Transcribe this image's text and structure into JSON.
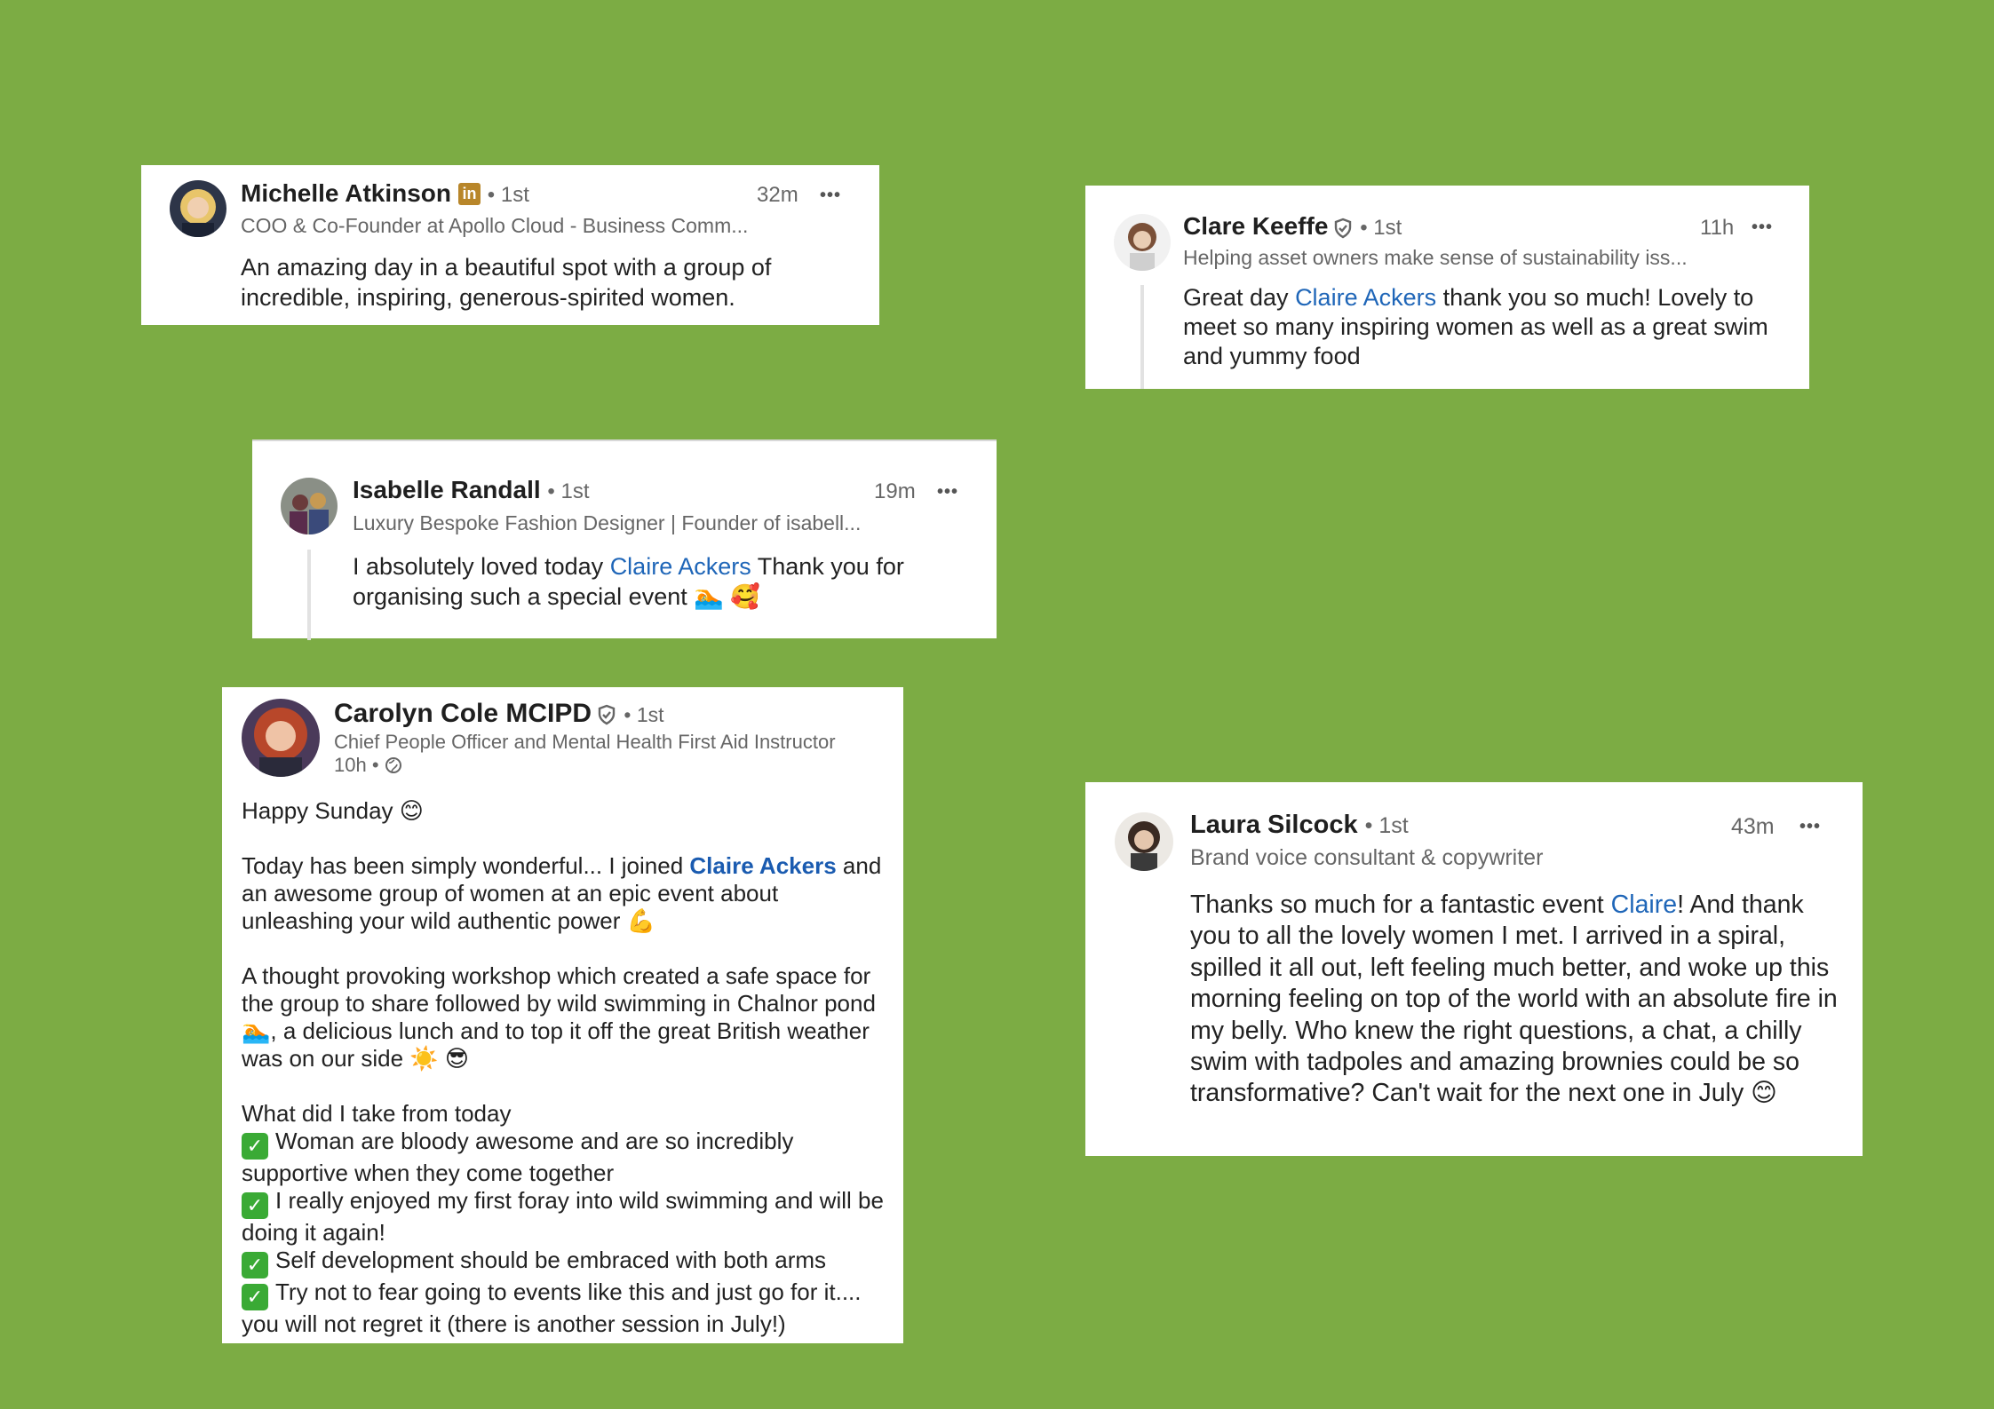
{
  "posts": {
    "michelle": {
      "name": "Michelle Atkinson",
      "badge_icon": "linkedin-icon",
      "badge_text": "in",
      "degree": "• 1st",
      "headline": "COO & Co-Founder at Apollo Cloud - Business Comm...",
      "time": "32m",
      "more": "•••",
      "text": "An amazing day in a beautiful spot with a group of incredible, inspiring, generous-spirited women."
    },
    "clare": {
      "name": "Clare Keeffe",
      "badge_icon": "verified-shield-icon",
      "degree": "• 1st",
      "headline": "Helping asset owners make sense of sustainability iss...",
      "time": "11h",
      "more": "•••",
      "text_before": "Great day ",
      "mention": "Claire Ackers",
      "text_after": " thank you so much! Lovely to meet so many inspiring women as well as a great swim and yummy food"
    },
    "isabelle": {
      "name": "Isabelle Randall",
      "degree": "• 1st",
      "headline": "Luxury Bespoke Fashion Designer | Founder of isabell...",
      "time": "19m",
      "more": "•••",
      "text_before": "I absolutely loved today ",
      "mention": "Claire Ackers",
      "text_after": " Thank you for organising such a special event 🏊 🥰"
    },
    "carolyn": {
      "name": "Carolyn Cole MCIPD",
      "badge_icon": "verified-shield-icon",
      "degree": "• 1st",
      "headline": "Chief People Officer and Mental Health First Aid Instructor",
      "meta": "10h •",
      "meta_icon": "globe-icon",
      "greeting": "Happy Sunday 😊",
      "para1_before": "Today has been simply wonderful... I joined ",
      "para1_mention": "Claire Ackers",
      "para1_after": " and an awesome group of women at an epic event about unleashing your wild authentic power 💪",
      "para2": "A thought provoking workshop which created a safe space for the group to share followed by wild swimming in Chalnor pond 🏊, a delicious lunch and to top it off the great British weather was on our side ☀️ 😎",
      "list_heading": "What did I take from today",
      "check_icon": "check-mark-icon",
      "check_glyph": "✓",
      "takeaways": [
        "Woman are bloody awesome and are so incredibly supportive when they come together",
        "I really enjoyed my first foray into wild swimming and will be doing it again!",
        "Self development should be embraced with both arms",
        "Try not to fear going to events like this and just go for it.... you will not regret it (there is another session in July!)"
      ]
    },
    "laura": {
      "name": "Laura Silcock",
      "degree": "• 1st",
      "headline": "Brand voice consultant & copywriter",
      "time": "43m",
      "more": "•••",
      "text_before": "Thanks so much for a fantastic event ",
      "mention": "Claire",
      "text_after": "! And thank you to all the lovely women I met. I arrived in a spiral, spilled it all out, left feeling much better, and woke up this morning feeling on top of the world with an absolute fire in my belly. Who knew the right questions, a chat, a chilly swim with tadpoles and amazing brownies could be so transformative? Can't wait for the next one in July 😊"
    }
  },
  "colors": {
    "background": "#7cac44",
    "card": "#ffffff",
    "mention": "#1f66b8",
    "linkedin_badge": "#b8862a",
    "check": "#3aaa35"
  }
}
